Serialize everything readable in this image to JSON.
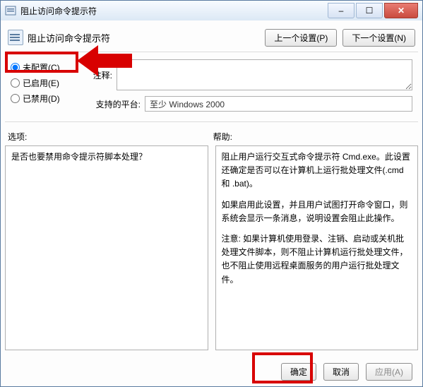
{
  "window": {
    "title": "阻止访问命令提示符"
  },
  "header": {
    "title": "阻止访问命令提示符",
    "prev": "上一个设置(P)",
    "next": "下一个设置(N)"
  },
  "radios": {
    "not_configured": "未配置(C)",
    "enabled": "已启用(E)",
    "disabled": "已禁用(D)",
    "selected": "not_configured"
  },
  "fields": {
    "comment_label": "注释:",
    "comment_value": "",
    "platform_label": "支持的平台:",
    "platform_value": "至少 Windows 2000"
  },
  "sections": {
    "options_label": "选项:",
    "help_label": "帮助:"
  },
  "options_panel_text": "是否也要禁用命令提示符脚本处理？",
  "help_panel_paragraphs": [
    "阻止用户运行交互式命令提示符 Cmd.exe。此设置还确定是否可以在计算机上运行批处理文件(.cmd 和 .bat)。",
    "如果启用此设置，并且用户试图打开命令窗口，则系统会显示一条消息，说明设置会阻止此操作。",
    "注意: 如果计算机使用登录、注销、启动或关机批处理文件脚本，则不阻止计算机运行批处理文件，也不阻止使用远程桌面服务的用户运行批处理文件。"
  ],
  "footer": {
    "ok": "确定",
    "cancel": "取消",
    "apply": "应用(A)"
  },
  "titlebar_icons": {
    "min": "–",
    "max": "☐",
    "close": "✕"
  }
}
